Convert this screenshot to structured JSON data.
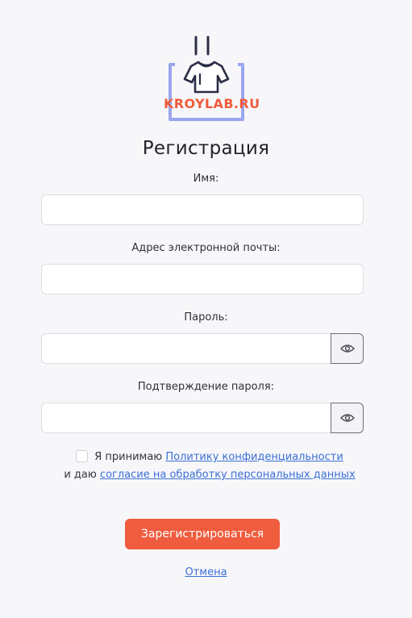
{
  "logo": {
    "text": "KROYLAB.RU",
    "icon": "shirt-in-frame-logo",
    "accent": "#f05c3e",
    "frame_color": "#9aa6f0"
  },
  "form": {
    "title": "Регистрация",
    "name_label": "Имя:",
    "name_value": "",
    "email_label": "Адрес электронной почты:",
    "email_value": "",
    "password_label": "Пароль:",
    "password_value": "",
    "confirm_label": "Подтверждение пароля:",
    "confirm_value": "",
    "toggle_icon": "eye-icon"
  },
  "consent": {
    "checked": false,
    "text_prefix": "Я принимаю",
    "privacy_link": "Политику конфиденциальности",
    "text_middle": "и даю",
    "consent_link": "согласие на обработку персональных данных"
  },
  "actions": {
    "submit_label": "Зарегистрироваться",
    "cancel_label": "Отмена"
  },
  "colors": {
    "primary": "#f05c3e",
    "link": "#3b6fd6",
    "background": "#f7f7fa"
  }
}
